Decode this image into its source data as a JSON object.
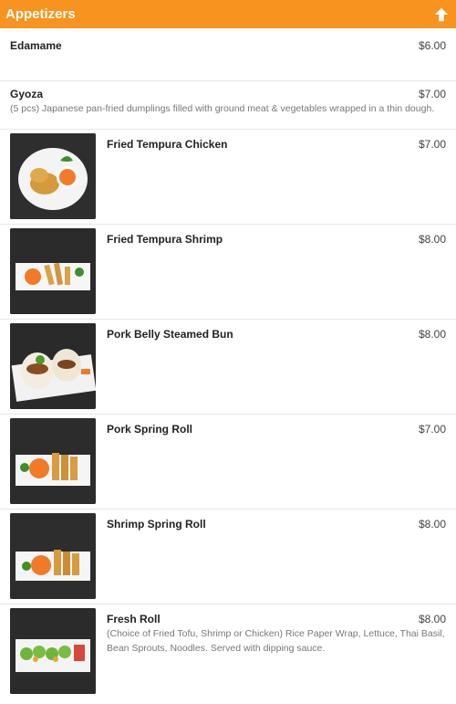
{
  "header": {
    "title": "Appetizers",
    "icon": "arrow-up-icon",
    "bg": "#f7931e"
  },
  "items": [
    {
      "name": "Edamame",
      "price": "$6.00",
      "description": ""
    },
    {
      "name": "Gyoza",
      "price": "$7.00",
      "description": "(5 pcs) Japanese pan-fried dumplings filled with ground meat & vegetables wrapped in a thin dough."
    },
    {
      "name": "Fried Tempura Chicken",
      "price": "$7.00",
      "description": ""
    },
    {
      "name": "Fried Tempura Shrimp",
      "price": "$8.00",
      "description": ""
    },
    {
      "name": "Pork Belly Steamed Bun",
      "price": "$8.00",
      "description": ""
    },
    {
      "name": "Pork Spring Roll",
      "price": "$7.00",
      "description": ""
    },
    {
      "name": "Shrimp Spring Roll",
      "price": "$8.00",
      "description": ""
    },
    {
      "name": "Fresh Roll",
      "price": "$8.00",
      "description": "(Choice of Fried Tofu, Shrimp or Chicken) Rice Paper Wrap, Lettuce, Thai Basil, Bean Sprouts, Noodles. Served with dipping sauce."
    }
  ]
}
